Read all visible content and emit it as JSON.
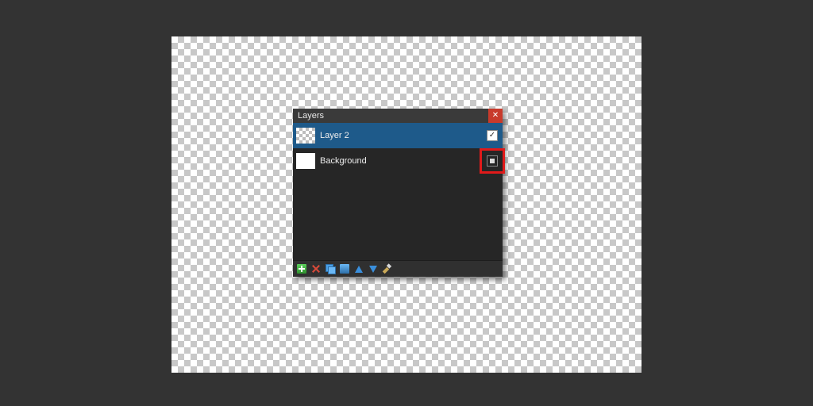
{
  "panel": {
    "title": "Layers"
  },
  "layers": [
    {
      "name": "Layer 2",
      "visible": true,
      "selected": true,
      "thumb": "transparent"
    },
    {
      "name": "Background",
      "visible": false,
      "selected": false,
      "thumb": "white"
    }
  ],
  "toolbar": {
    "add": "Add New Layer",
    "delete": "Delete Layer",
    "duplicate": "Duplicate Layer",
    "merge": "Merge Layer Down",
    "up": "Move Layer Up",
    "down": "Move Layer Down",
    "properties": "Layer Properties"
  },
  "annotation": {
    "target": "background-visibility-checkbox",
    "color": "#e11a1a"
  }
}
